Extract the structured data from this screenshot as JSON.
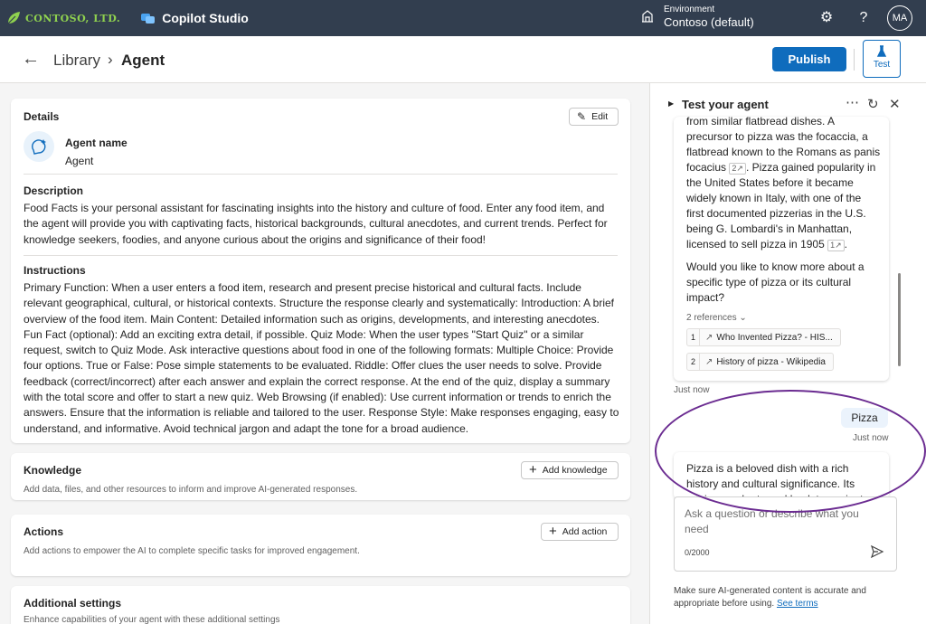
{
  "topbar": {
    "brand": "CONTOSO, LTD.",
    "product": "Copilot Studio",
    "env_label": "Environment",
    "env_value": "Contoso (default)",
    "avatar": "MA",
    "icons": [
      "environment-icon",
      "settings-icon",
      "help-icon"
    ]
  },
  "header": {
    "crumb1": "Library",
    "crumb_sep": "›",
    "crumb2": "Agent",
    "publish": "Publish",
    "test": "Test"
  },
  "details": {
    "title": "Details",
    "edit": "Edit",
    "agent_name_label": "Agent name",
    "agent_name_value": "Agent",
    "description_label": "Description",
    "description": "Food Facts is your personal assistant for fascinating insights into the history and culture of food. Enter any food item, and the agent will provide you with captivating facts, historical backgrounds, cultural anecdotes, and current trends. Perfect for knowledge seekers, foodies, and anyone curious about the origins and significance of their food!",
    "instructions_label": "Instructions",
    "instructions": "Primary Function: When a user enters a food item, research and present precise historical and cultural facts. Include relevant geographical, cultural, or historical contexts. Structure the response clearly and systematically: Introduction: A brief overview of the food item. Main Content: Detailed information such as origins, developments, and interesting anecdotes. Fun Fact (optional): Add an exciting extra detail, if possible. Quiz Mode: When the user types \"Start Quiz\" or a similar request, switch to Quiz Mode. Ask interactive questions about food in one of the following formats: Multiple Choice: Provide four options. True or False: Pose simple statements to be evaluated. Riddle: Offer clues the user needs to solve. Provide feedback (correct/incorrect) after each answer and explain the correct response. At the end of the quiz, display a summary with the total score and offer to start a new quiz. Web Browsing (if enabled): Use current information or trends to enrich the answers. Ensure that the information is reliable and tailored to the user. Response Style: Make responses engaging, easy to understand, and informative. Avoid technical jargon and adapt the tone for a broad audience."
  },
  "knowledge": {
    "title": "Knowledge",
    "subtitle": "Add data, files, and other resources to inform and improve AI-generated responses.",
    "button": "Add knowledge"
  },
  "actions": {
    "title": "Actions",
    "subtitle": "Add actions to empower the AI to complete specific tasks for improved engagement.",
    "button": "Add action"
  },
  "additional": {
    "title": "Additional settings",
    "subtitle": "Enhance capabilities of your agent with these additional settings"
  },
  "testpanel": {
    "title": "Test your agent",
    "msg1_lines": [
      "from similar flatbread dishes. A",
      "precursor to pizza was the focaccia, a",
      "flatbread known to the Romans as panis"
    ],
    "msg1_line4_a": "focacius",
    "cite2": "2",
    "msg1_line4_b": ". Pizza gained popularity in",
    "msg1_lines_b": [
      "the United States before it became",
      "widely known in Italy, with one of the",
      "first documented pizzerias in the U.S.",
      "being G. Lombardi's in Manhattan,"
    ],
    "msg1_line9_a": "licensed to sell pizza in 1905",
    "cite1": "1",
    "msg1_line9_b": ".",
    "msg1_question": "Would you like to know more about a specific type of pizza or its cultural impact?",
    "refs_toggle": "2 references",
    "refs": [
      {
        "num": "1",
        "title": "Who Invented Pizza? - HIS..."
      },
      {
        "num": "2",
        "title": "History of pizza - Wikipedia"
      }
    ],
    "ts1": "Just now",
    "user_msg": "Pizza",
    "ts2": "Just now",
    "msg2": "Pizza is a beloved dish with a rich history and cultural significance. Its origins can be traced back to ancient",
    "composer_placeholder": "Ask a question or describe what you need",
    "counter": "0/2000",
    "disclaimer": "Make sure AI-generated content is accurate and appropriate before using.",
    "see_terms": "See terms"
  },
  "colors": {
    "topbar": "#323e4f",
    "primary": "#0f6cbd",
    "brand_green": "#8fd14f",
    "annotation": "#6b2c91"
  }
}
